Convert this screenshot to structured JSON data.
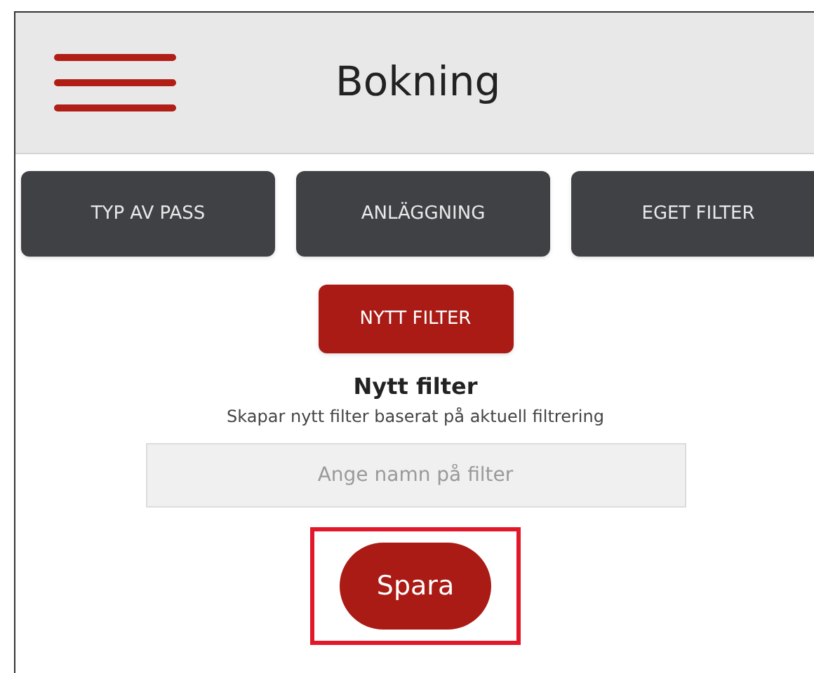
{
  "header": {
    "title": "Bokning"
  },
  "tabs": [
    {
      "label": "TYP AV PASS"
    },
    {
      "label": "ANLÄGGNING"
    },
    {
      "label": "EGET FILTER"
    }
  ],
  "new_filter_button": "NYTT FILTER",
  "section": {
    "heading": "Nytt filter",
    "description": "Skapar nytt filter baserat på aktuell filtrering"
  },
  "name_field": {
    "placeholder": "Ange namn på filter"
  },
  "save_button": {
    "label": "Spara",
    "highlighted": true
  }
}
